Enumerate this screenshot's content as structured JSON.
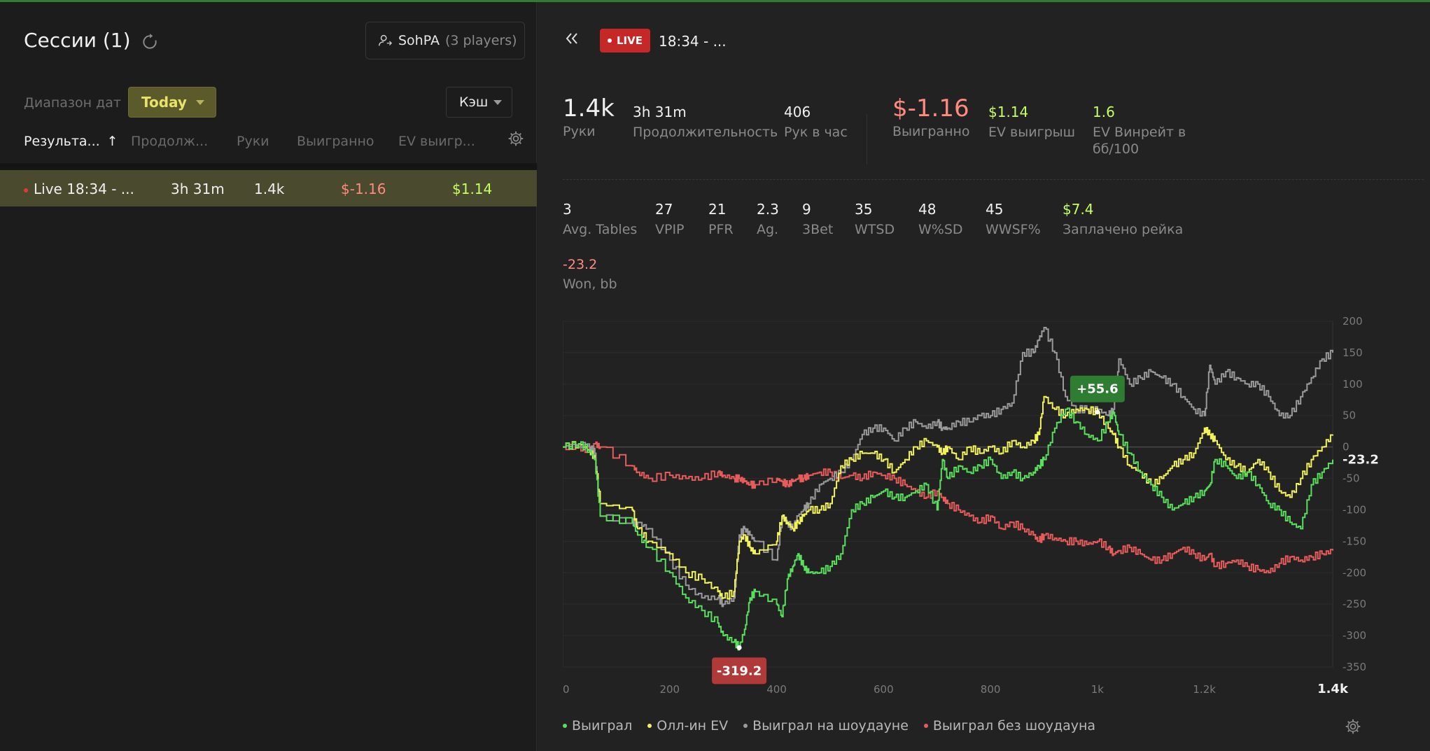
{
  "sidebar": {
    "title": "Сессии (1)",
    "player": {
      "name": "SohPA",
      "count": "(3 players)"
    },
    "date_label": "Диапазон дат",
    "date_value": "Today",
    "type_value": "Кэш",
    "columns": [
      "Результа...",
      "Продолж...",
      "Руки",
      "Выигранно",
      "EV выигр..."
    ],
    "sessions": [
      {
        "name": "Live 18:34 - ...",
        "duration": "3h 31m",
        "hands": "1.4k",
        "won": "$-1.16",
        "ev_won": "$1.14"
      }
    ]
  },
  "header": {
    "live_label": "LIVE",
    "session_title": "18:34 - ..."
  },
  "stats_top": [
    {
      "value": "1.4k",
      "label": "Руки"
    },
    {
      "value": "3h 31m",
      "label": "Продолжительность"
    },
    {
      "value": "406",
      "label": "Рук в час"
    },
    {
      "value": "$-1.16",
      "label": "Выигранно"
    },
    {
      "value": "$1.14",
      "label": "EV выигрыш"
    },
    {
      "value": "1.6",
      "label": "EV Винрейт в",
      "label2": "бб/100"
    }
  ],
  "stats_mid": [
    {
      "value": "3",
      "label": "Avg. Tables"
    },
    {
      "value": "27",
      "label": "VPIP"
    },
    {
      "value": "21",
      "label": "PFR"
    },
    {
      "value": "2.3",
      "label": "Ag."
    },
    {
      "value": "9",
      "label": "3Bet"
    },
    {
      "value": "35",
      "label": "WTSD"
    },
    {
      "value": "48",
      "label": "W%SD"
    },
    {
      "value": "45",
      "label": "WWSF%"
    },
    {
      "value": "$7.4",
      "label": "Заплачено рейка"
    }
  ],
  "stats_won": {
    "value": "-23.2",
    "label": "Won, bb"
  },
  "colors": {
    "green": "#58e05c",
    "yellow": "#f2f25a",
    "gray": "#9a9a9a",
    "red": "#e85b5b"
  },
  "chart_data": {
    "type": "line",
    "x_ticks": [
      "0",
      "200",
      "400",
      "600",
      "800",
      "1k",
      "1.2k",
      "1.4k"
    ],
    "y_ticks": [
      "200",
      "150",
      "100",
      "50",
      "0",
      "-50",
      "-100",
      "-150",
      "-200",
      "-250",
      "-300",
      "-350"
    ],
    "xlim": [
      0,
      1440
    ],
    "ylim": [
      -350,
      200
    ],
    "legend_position": "bottom-left",
    "series": [
      {
        "name": "Выиграл",
        "color": "green",
        "x": [
          0,
          30,
          50,
          60,
          70,
          130,
          140,
          160,
          200,
          230,
          260,
          290,
          300,
          320,
          330,
          340,
          350,
          360,
          400,
          410,
          420,
          430,
          440,
          450,
          460,
          480,
          500,
          520,
          540,
          560,
          580,
          600,
          620,
          640,
          660,
          680,
          700,
          710,
          720,
          740,
          760,
          780,
          800,
          820,
          840,
          860,
          880,
          890,
          900,
          920,
          940,
          960,
          980,
          1000,
          1020,
          1030,
          1040,
          1060,
          1080,
          1100,
          1120,
          1140,
          1160,
          1180,
          1200,
          1210,
          1220,
          1240,
          1260,
          1280,
          1300,
          1320,
          1340,
          1360,
          1380,
          1400,
          1420,
          1440
        ],
        "y": [
          0,
          5,
          -5,
          -20,
          -110,
          -120,
          -140,
          -160,
          -200,
          -240,
          -260,
          -280,
          -300,
          -310,
          -319,
          -290,
          -240,
          -230,
          -250,
          -270,
          -210,
          -190,
          -170,
          -190,
          -200,
          -200,
          -190,
          -170,
          -100,
          -90,
          -80,
          -70,
          -80,
          -80,
          -70,
          -60,
          -100,
          -20,
          -50,
          -30,
          -40,
          -30,
          -20,
          -50,
          -40,
          -50,
          -40,
          -30,
          -20,
          30,
          60,
          40,
          20,
          10,
          40,
          55,
          20,
          -10,
          -40,
          -60,
          -80,
          -100,
          -90,
          -80,
          -70,
          -60,
          -20,
          -30,
          -50,
          -40,
          -60,
          -90,
          -100,
          -120,
          -130,
          -60,
          -40,
          -20
        ]
      },
      {
        "name": "Олл-ин EV",
        "color": "yellow",
        "x": [
          0,
          30,
          50,
          60,
          70,
          130,
          140,
          160,
          200,
          230,
          260,
          290,
          300,
          320,
          330,
          340,
          350,
          360,
          400,
          410,
          420,
          430,
          440,
          450,
          460,
          480,
          500,
          520,
          540,
          560,
          580,
          600,
          620,
          640,
          660,
          680,
          700,
          710,
          720,
          740,
          760,
          780,
          800,
          820,
          840,
          860,
          880,
          890,
          900,
          920,
          940,
          960,
          980,
          1000,
          1020,
          1030,
          1040,
          1060,
          1080,
          1100,
          1120,
          1140,
          1160,
          1180,
          1200,
          1210,
          1220,
          1240,
          1260,
          1280,
          1300,
          1320,
          1340,
          1360,
          1380,
          1400,
          1420,
          1440
        ],
        "y": [
          0,
          5,
          -5,
          -20,
          -90,
          -100,
          -130,
          -150,
          -170,
          -200,
          -210,
          -230,
          -240,
          -230,
          -150,
          -140,
          -160,
          -170,
          -150,
          -110,
          -120,
          -130,
          -120,
          -110,
          -100,
          -100,
          -90,
          -30,
          -20,
          -10,
          -10,
          -20,
          -40,
          -20,
          0,
          10,
          0,
          -10,
          0,
          -20,
          0,
          -10,
          0,
          -10,
          10,
          0,
          10,
          20,
          80,
          60,
          50,
          60,
          60,
          55,
          30,
          20,
          0,
          -30,
          -40,
          -60,
          -50,
          -30,
          -20,
          -10,
          30,
          20,
          10,
          -20,
          -30,
          -40,
          -20,
          -40,
          -70,
          -80,
          -50,
          -20,
          0,
          20
        ]
      },
      {
        "name": "Выиграл на шоудауне",
        "color": "gray",
        "x": [
          0,
          30,
          50,
          60,
          70,
          130,
          140,
          160,
          200,
          230,
          260,
          290,
          300,
          320,
          330,
          340,
          350,
          360,
          400,
          410,
          420,
          430,
          440,
          450,
          460,
          480,
          500,
          520,
          540,
          560,
          580,
          600,
          620,
          640,
          660,
          680,
          700,
          710,
          720,
          740,
          760,
          780,
          800,
          820,
          840,
          860,
          880,
          890,
          900,
          920,
          940,
          960,
          980,
          1000,
          1020,
          1030,
          1040,
          1060,
          1080,
          1100,
          1120,
          1140,
          1160,
          1180,
          1200,
          1210,
          1220,
          1240,
          1260,
          1280,
          1300,
          1320,
          1340,
          1360,
          1380,
          1400,
          1420,
          1440
        ],
        "y": [
          0,
          5,
          0,
          -10,
          -110,
          -120,
          -120,
          -130,
          -180,
          -220,
          -240,
          -240,
          -250,
          -240,
          -140,
          -130,
          -140,
          -150,
          -180,
          -110,
          -120,
          -130,
          -110,
          -100,
          -90,
          -60,
          -50,
          -40,
          -20,
          20,
          30,
          30,
          10,
          30,
          40,
          30,
          40,
          30,
          30,
          40,
          40,
          50,
          50,
          60,
          70,
          150,
          150,
          170,
          190,
          150,
          80,
          60,
          60,
          60,
          50,
          60,
          140,
          100,
          110,
          120,
          110,
          100,
          80,
          60,
          50,
          130,
          100,
          120,
          110,
          100,
          100,
          80,
          50,
          50,
          80,
          110,
          140,
          150
        ]
      },
      {
        "name": "Выиграл без шоудауна",
        "color": "red",
        "x": [
          0,
          30,
          50,
          60,
          70,
          130,
          140,
          160,
          200,
          230,
          260,
          290,
          300,
          320,
          330,
          340,
          350,
          360,
          400,
          410,
          420,
          430,
          440,
          450,
          460,
          480,
          500,
          520,
          540,
          560,
          580,
          600,
          620,
          640,
          660,
          680,
          700,
          710,
          720,
          740,
          760,
          780,
          800,
          820,
          840,
          860,
          880,
          890,
          900,
          920,
          940,
          960,
          980,
          1000,
          1020,
          1030,
          1040,
          1060,
          1080,
          1100,
          1120,
          1140,
          1160,
          1180,
          1200,
          1210,
          1220,
          1240,
          1260,
          1280,
          1300,
          1320,
          1340,
          1360,
          1380,
          1400,
          1420,
          1440
        ],
        "y": [
          0,
          0,
          -5,
          5,
          0,
          -30,
          -40,
          -50,
          -45,
          -50,
          -50,
          -40,
          -45,
          -50,
          -50,
          -55,
          -60,
          -60,
          -50,
          -55,
          -60,
          -55,
          -50,
          -50,
          -45,
          -40,
          -40,
          -50,
          -45,
          -50,
          -40,
          -45,
          -50,
          -60,
          -70,
          -80,
          -70,
          -80,
          -90,
          -100,
          -110,
          -120,
          -110,
          -130,
          -120,
          -130,
          -140,
          -150,
          -140,
          -145,
          -150,
          -150,
          -155,
          -150,
          -160,
          -170,
          -165,
          -160,
          -170,
          -180,
          -180,
          -170,
          -160,
          -170,
          -180,
          -170,
          -190,
          -185,
          -180,
          -190,
          -195,
          -200,
          -185,
          -175,
          -180,
          -175,
          -170,
          -165
        ]
      }
    ],
    "annotations": [
      {
        "label": "+55.6",
        "x": 1000,
        "y": 55.6,
        "color": "#2e7d32"
      },
      {
        "label": "-319.2",
        "x": 330,
        "y": -319.2,
        "color": "#b03a3a"
      }
    ],
    "end_value": "-23.2"
  }
}
